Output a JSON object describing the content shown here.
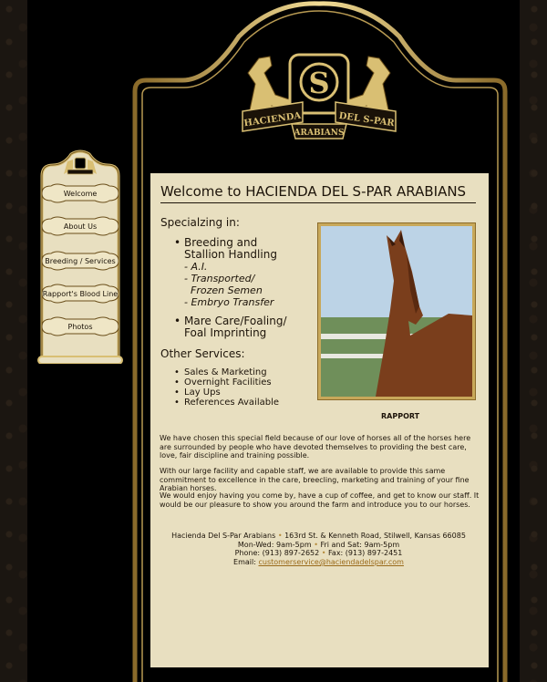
{
  "site": {
    "logo_top_text": "HACIENDA",
    "logo_mid_text": "DEL S-PAR",
    "logo_bottom_text": "ARABIANS",
    "logo_monogram": "S"
  },
  "nav": [
    {
      "label": "Welcome"
    },
    {
      "label": "About Us"
    },
    {
      "label": "Breeding / Services"
    },
    {
      "label": "Rapport's Blood Line"
    },
    {
      "label": "Photos"
    }
  ],
  "main": {
    "title": "Welcome to HACIENDA DEL S-PAR ARABIANS",
    "specializing_heading": "Specialzing in:",
    "specialties": {
      "breeding_line1": "Breeding and",
      "breeding_line2": "Stallion Handling",
      "sub1": "- A.I.",
      "sub2": "- Transported/",
      "sub3": "  Frozen Semen",
      "sub4": "- Embryo Transfer",
      "mare_line1": "Mare Care/Foaling/",
      "mare_line2": "Foal Imprinting"
    },
    "other_heading": "Other Services:",
    "other_services": [
      "Sales & Marketing",
      "Overnight Facilities",
      "Lay Ups",
      "References Available"
    ],
    "photo_caption": "RAPPORT",
    "paragraphs": [
      "We have chosen this special field because of our love of horses all of the horses here are surrounded by people who have devoted themselves to providing the best care, love, fair discipline and training possible.",
      "With our large facility and capable staff, we are available to provide this same commitment to excellence in the care, breecling, marketing and training of your fine Arabian horses.",
      "We would enjoy having you come by, have a cup of coffee, and get to know our staff. It would be our pleasure to show you around the farm and introduce you to our horses."
    ]
  },
  "footer": {
    "name": "Hacienda Del S-Par Arabians",
    "address": "163rd St. & Kenneth Road, Stilwell, Kansas 66085",
    "hours1": "Mon-Wed: 9am-5pm",
    "hours2": "Fri and Sat: 9am-5pm",
    "phone": "Phone: (913) 897-2652",
    "fax": "Fax: (913) 897-2451",
    "email_label": "Email:",
    "email": "customerservice@haciendadelspar.com",
    "separator": "•"
  },
  "colors": {
    "gold": "#d9bf73",
    "panel": "#e8dfc0",
    "ink": "#1d140a"
  }
}
